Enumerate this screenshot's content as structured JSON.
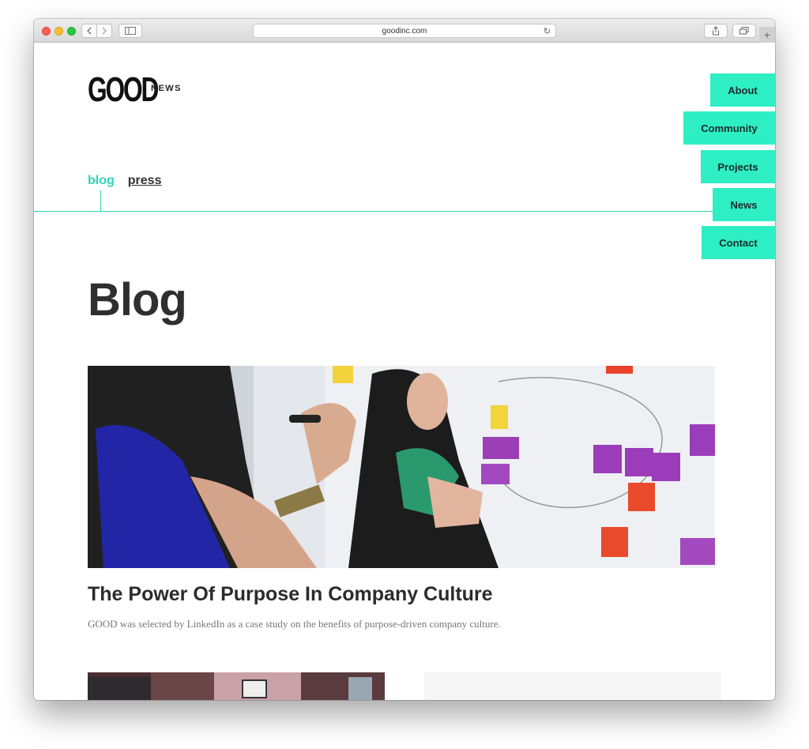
{
  "browser": {
    "url": "goodinc.com",
    "new_tab_symbol": "+"
  },
  "site": {
    "logo": "GOOD",
    "logo_sub": "NEWS"
  },
  "main_nav": [
    {
      "label": "About"
    },
    {
      "label": "Community"
    },
    {
      "label": "Projects"
    },
    {
      "label": "News"
    },
    {
      "label": "Contact"
    }
  ],
  "sub_nav": {
    "active": "blog",
    "link": "press"
  },
  "page_title": "Blog",
  "featured_post": {
    "title": "The Power Of Purpose In Company Culture",
    "excerpt": "GOOD was selected by LinkedIn as a case study on the benefits of purpose-driven company culture."
  },
  "colors": {
    "accent": "#2ed6b4",
    "nav_bg": "#2eeec4",
    "text_dark": "#2f2f2f"
  }
}
